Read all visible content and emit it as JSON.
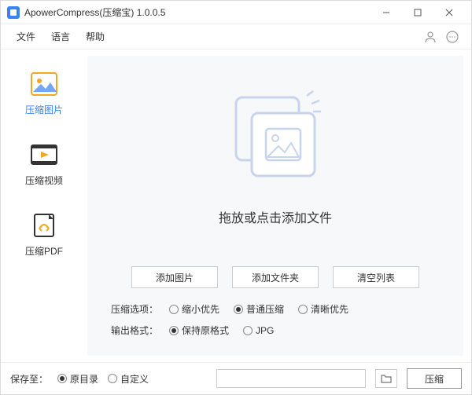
{
  "title": "ApowerCompress(压缩宝)  1.0.0.5",
  "menu": {
    "file": "文件",
    "language": "语言",
    "help": "帮助"
  },
  "sidebar": {
    "image": "压缩图片",
    "video": "压缩视频",
    "pdf": "压缩PDF"
  },
  "main": {
    "drop_text": "拖放或点击添加文件",
    "add_image": "添加图片",
    "add_folder": "添加文件夹",
    "clear_list": "清空列表"
  },
  "options": {
    "compress_label": "压缩选项：",
    "compress": {
      "smaller": "缩小优先",
      "normal": "普通压缩",
      "clear": "清晰优先"
    },
    "format_label": "输出格式：",
    "format": {
      "keep": "保持原格式",
      "jpg": "JPG"
    }
  },
  "footer": {
    "save_to": "保存至：",
    "original": "原目录",
    "custom": "自定义",
    "compress": "压缩"
  }
}
